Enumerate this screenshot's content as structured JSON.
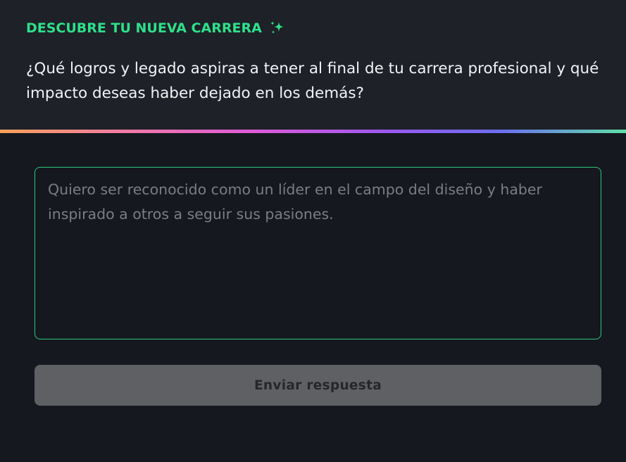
{
  "header": {
    "eyebrow": "DESCUBRE TU NUEVA CARRERA",
    "eyebrow_icon": "sparkle-icon",
    "question": "¿Qué logros y legado aspiras a tener al final de tu carrera profesional y qué impacto deseas haber dejado en los demás?"
  },
  "answer": {
    "value": "",
    "placeholder": "Quiero ser reconocido como un líder en el campo del diseño y haber inspirado a otros a seguir sus pasiones."
  },
  "submit": {
    "label": "Enviar respuesta",
    "state": "disabled"
  },
  "colors": {
    "accent": "#2ee08a",
    "background": "#15181f",
    "header_background": "#1e2128",
    "button_disabled": "#5e6063",
    "divider_gradient": [
      "#f6a25a",
      "#f27aa6",
      "#e05ad8",
      "#9a58f0",
      "#6c6ef0",
      "#5fe0a8"
    ]
  }
}
